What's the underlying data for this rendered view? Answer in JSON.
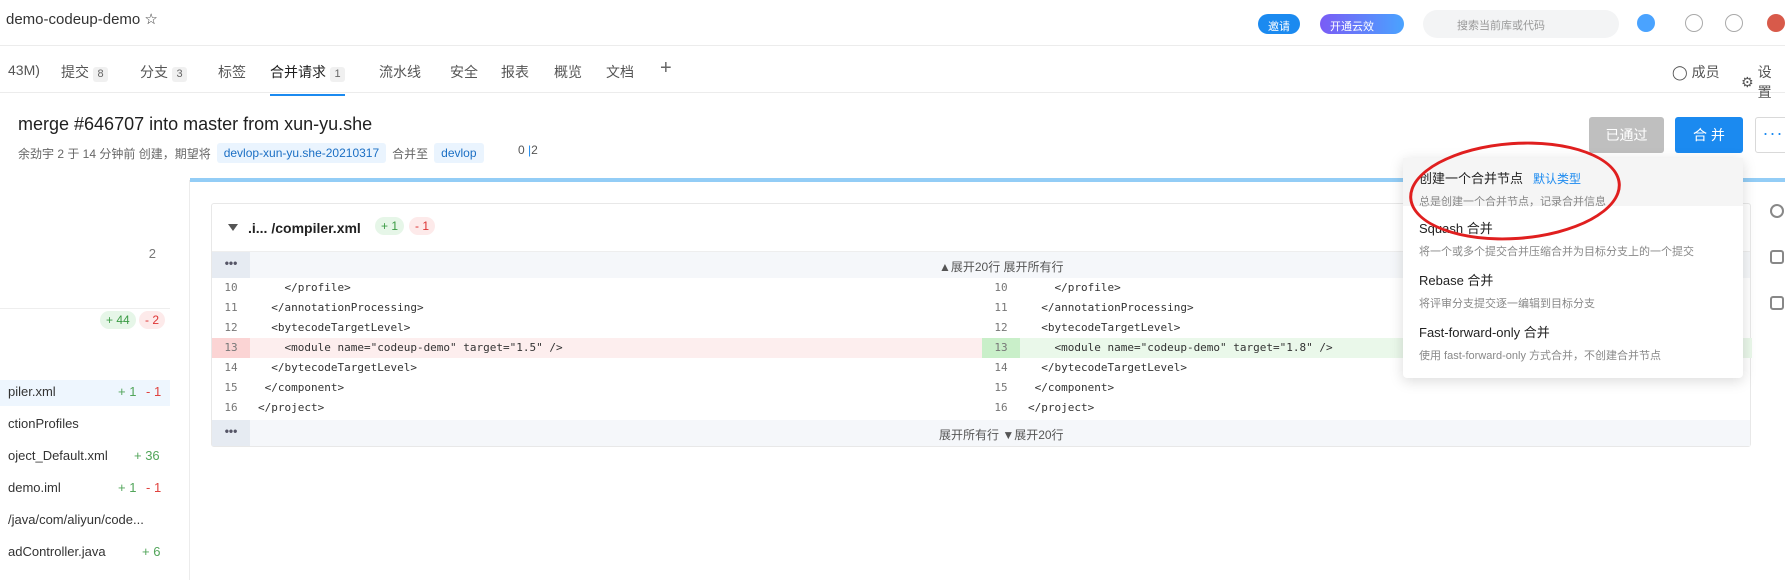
{
  "header": {
    "repo_name": "demo-codeup-demo",
    "star_glyph": "☆",
    "pill_blue": "邀请",
    "pill_purple": "开通云效",
    "search_placeholder": "搜索当前库或代码"
  },
  "tabs": [
    {
      "label": "43M)",
      "count": ""
    },
    {
      "label": "提交",
      "count": "8"
    },
    {
      "label": "分支",
      "count": "3"
    },
    {
      "label": "标签",
      "count": ""
    },
    {
      "label": "合并请求",
      "count": "1"
    },
    {
      "label": "流水线",
      "count": ""
    },
    {
      "label": "安全",
      "count": ""
    },
    {
      "label": "报表",
      "count": ""
    },
    {
      "label": "概览",
      "count": ""
    },
    {
      "label": "文档",
      "count": ""
    }
  ],
  "tab_add_glyph": "+",
  "tab_members": "成员",
  "tab_settings": "设置",
  "mr": {
    "title": "merge #646707 into master from xun-yu.she",
    "meta_prefix": "余劲宇 2 于 14 分钟前 创建，期望将",
    "source_branch": "devlop-xun-yu.she-20210317",
    "merge_to": "合并至",
    "target_branch": "devlop",
    "version_a": "0",
    "version_b": "2",
    "btn_approved": "已通过",
    "btn_merge": "合 并",
    "btn_more": "···"
  },
  "sidebar": {
    "count": "2",
    "summary_add": "+ 44",
    "summary_del": "- 2",
    "files": [
      {
        "name": "piler.xml",
        "add": "+ 1",
        "del": "- 1"
      },
      {
        "name": "ctionProfiles",
        "add": "",
        "del": ""
      },
      {
        "name": "oject_Default.xml",
        "add": "+ 36",
        "del": ""
      },
      {
        "name": "demo.iml",
        "add": "+ 1",
        "del": "- 1"
      },
      {
        "name": "/java/com/aliyun/code...",
        "add": "",
        "del": ""
      },
      {
        "name": "adController.java",
        "add": "+ 6",
        "del": ""
      }
    ]
  },
  "diff": {
    "filename": ".i... /compiler.xml",
    "add_chip": "+ 1",
    "del_chip": "- 1",
    "expand_top": "▲展开20行   展开所有行",
    "expand_bottom": "展开所有行   ▼展开20行",
    "dots": "•••",
    "lines": [
      {
        "no": "10",
        "text": "    </profile>"
      },
      {
        "no": "11",
        "text": "  </annotationProcessing>"
      },
      {
        "no": "12",
        "text": "  <bytecodeTargetLevel>"
      },
      {
        "no": "13",
        "text": "    <module name=\"codeup-demo\" target=\"1.5\" />"
      },
      {
        "no": "14",
        "text": "  </bytecodeTargetLevel>"
      },
      {
        "no": "15",
        "text": " </component>"
      },
      {
        "no": "16",
        "text": "</project>"
      }
    ],
    "lines_right_changed": "    <module name=\"codeup-demo\" target=\"1.8\" />"
  },
  "dropdown": {
    "items": [
      {
        "title": "创建一个合并节点",
        "tag": "默认类型",
        "desc": "总是创建一个合并节点，记录合并信息"
      },
      {
        "title": "Squash 合并",
        "tag": "",
        "desc": "将一个或多个提交合并压缩合并为目标分支上的一个提交"
      },
      {
        "title": "Rebase 合并",
        "tag": "",
        "desc": "将评审分支提交逐一编辑到目标分支"
      },
      {
        "title": "Fast-forward-only 合并",
        "tag": "",
        "desc": "使用 fast-forward-only 方式合并，不创建合并节点"
      }
    ]
  },
  "colors": {
    "accent": "#1b8af0",
    "approved": "#bfbfbf",
    "annotation": "#e01f1f"
  }
}
